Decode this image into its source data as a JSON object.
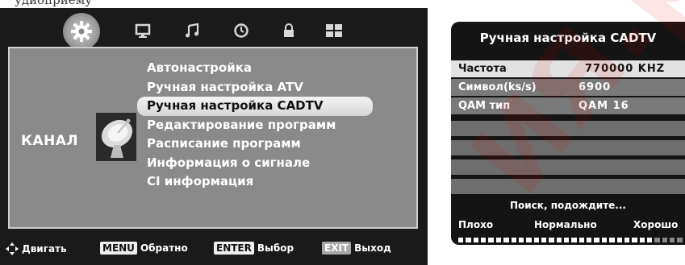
{
  "page_top_text": "удиоприему",
  "left_menu": {
    "tabs": [
      {
        "icon": "gear-icon",
        "active": true
      },
      {
        "icon": "monitor-icon",
        "active": false
      },
      {
        "icon": "music-note-icon",
        "active": false
      },
      {
        "icon": "clock-icon",
        "active": false
      },
      {
        "icon": "lock-icon",
        "active": false
      },
      {
        "icon": "grid-icon",
        "active": false
      }
    ],
    "category_label": "КАНАЛ",
    "category_icon": "satellite-dish-icon",
    "items": [
      "Автонастройка",
      "Ручная настройка ATV",
      "Ручная настройка CADTV",
      "Редактирование программ",
      "Расписание программ",
      "Информация о сигнале",
      "CI информация"
    ],
    "selected_index": 2,
    "hints": {
      "move_label": "Двигать",
      "menu_key": "MENU",
      "back_label": "Обратно",
      "enter_key": "ENTER",
      "select_label": "Выбор",
      "exit_key": "EXIT",
      "exit_label": "Выход"
    }
  },
  "right_panel": {
    "title": "Ручная настройка CADTV",
    "fields": [
      {
        "label": "Частота",
        "value": "770000 KHZ",
        "selected": true
      },
      {
        "label": "Символ(ks/s)",
        "value": "6900",
        "selected": false
      },
      {
        "label": "QAM тип",
        "value": "QAM 16",
        "selected": false
      }
    ],
    "status_text": "Поиск, подождите...",
    "quality_labels": [
      "Плохо",
      "Нормально",
      "Хорошо"
    ],
    "signal_level_fraction": 0.87
  },
  "watermark_text": "ия.рф"
}
